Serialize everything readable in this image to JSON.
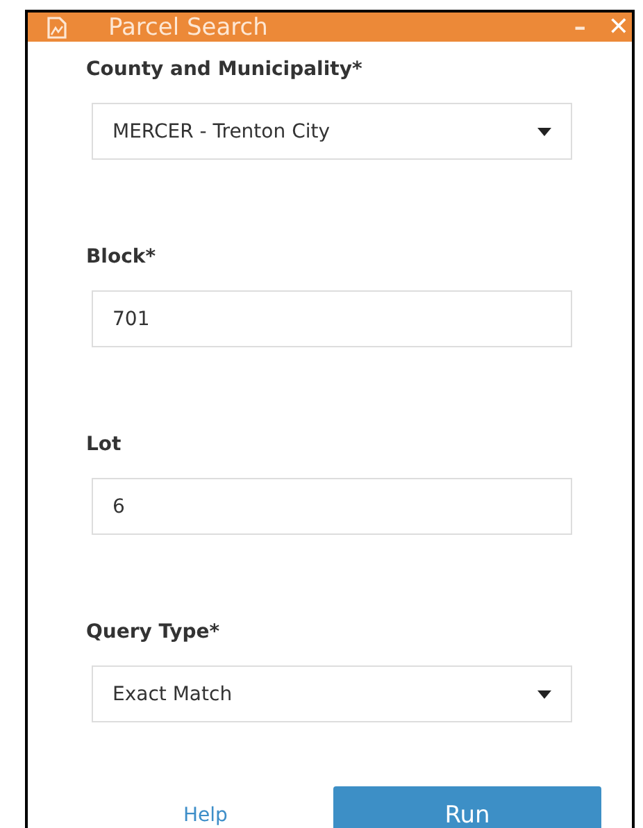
{
  "window": {
    "title": "Parcel Search",
    "minimize": "–",
    "close": "✕"
  },
  "fields": [
    {
      "label": "County and Municipality*",
      "kind": "select",
      "value": "MERCER - Trenton City"
    },
    {
      "label": "Block*",
      "kind": "text",
      "value": "701"
    },
    {
      "label": "Lot",
      "kind": "text",
      "value": "6"
    },
    {
      "label": "Query Type*",
      "kind": "select",
      "value": "Exact Match"
    }
  ],
  "help_link": "Help",
  "run_button": "Run"
}
